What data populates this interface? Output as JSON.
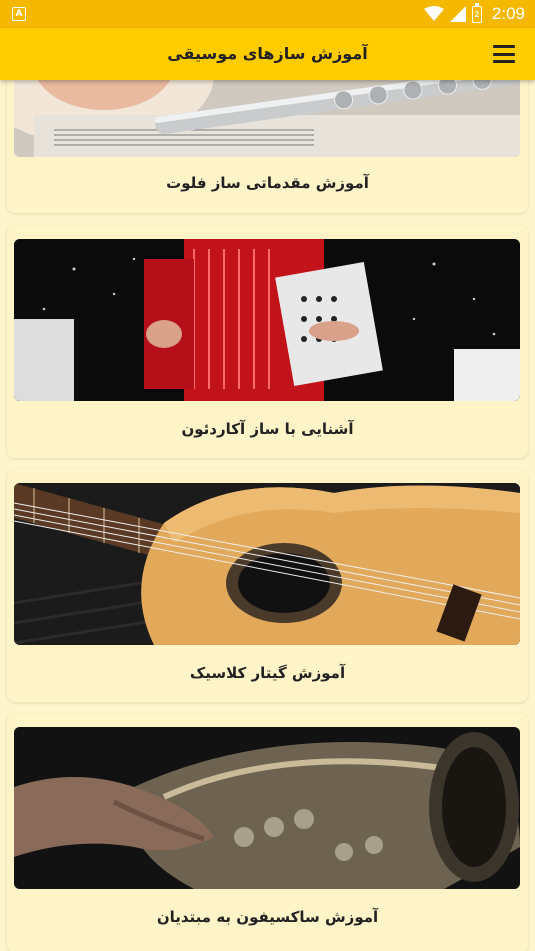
{
  "status_bar": {
    "time": "2:09",
    "notification_icon": "a-notification-icon",
    "icons": [
      "wifi-icon",
      "signal-icon",
      "battery-icon"
    ],
    "battery_glyph": "2"
  },
  "app_bar": {
    "title": "آموزش سازهای موسیقی",
    "menu_icon": "hamburger-menu-icon"
  },
  "cards": [
    {
      "title": "آموزش مقدماتی ساز فلوت",
      "image": "flute-image"
    },
    {
      "title": "آشنایی با ساز آکاردئون",
      "image": "accordion-image"
    },
    {
      "title": "آموزش گیتار کلاسیک",
      "image": "guitar-image"
    },
    {
      "title": "آموزش ساکسیفون به مبتدیان",
      "image": "saxophone-image"
    }
  ],
  "colors": {
    "status_bar": "#f5b800",
    "app_bar": "#ffcc00",
    "background": "#fff5cc",
    "card": "#fff4c8",
    "text": "#222222"
  }
}
